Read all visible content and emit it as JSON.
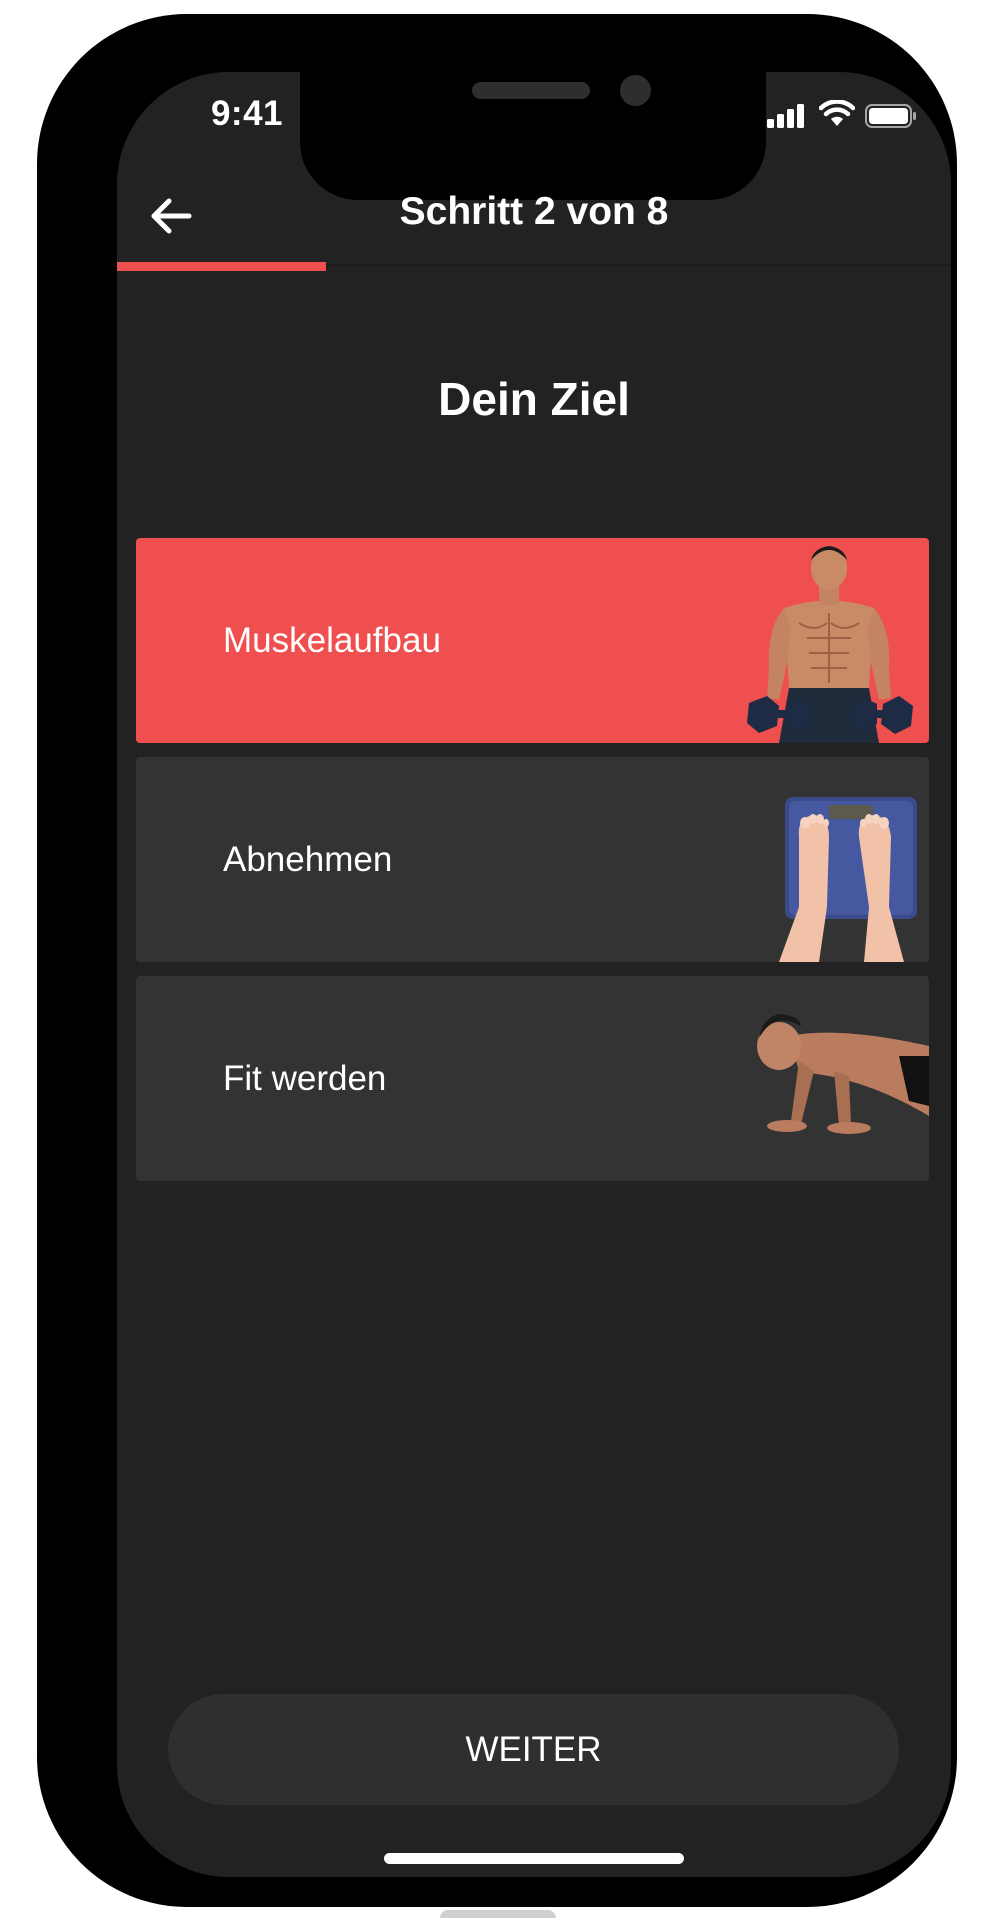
{
  "status_bar": {
    "time": "9:41",
    "icons": [
      "signal-icon",
      "wifi-icon",
      "battery-icon"
    ]
  },
  "nav": {
    "back_icon": "arrow-left-icon",
    "title": "Schritt 2 von 8"
  },
  "progress": {
    "current_step": 2,
    "total_steps": 8,
    "fraction": 0.25,
    "color": "#ef4f4f"
  },
  "page": {
    "title": "Dein Ziel"
  },
  "goals": [
    {
      "label": "Muskelaufbau",
      "selected": true,
      "image": "muscle-man-dumbbells"
    },
    {
      "label": "Abnehmen",
      "selected": false,
      "image": "feet-on-scale"
    },
    {
      "label": "Fit werden",
      "selected": false,
      "image": "man-doing-pushup"
    }
  ],
  "footer": {
    "button_label": "WEITER"
  },
  "colors": {
    "background": "#222222",
    "card": "#333333",
    "accent": "#ef4f4f",
    "button": "#2f2f2f"
  }
}
